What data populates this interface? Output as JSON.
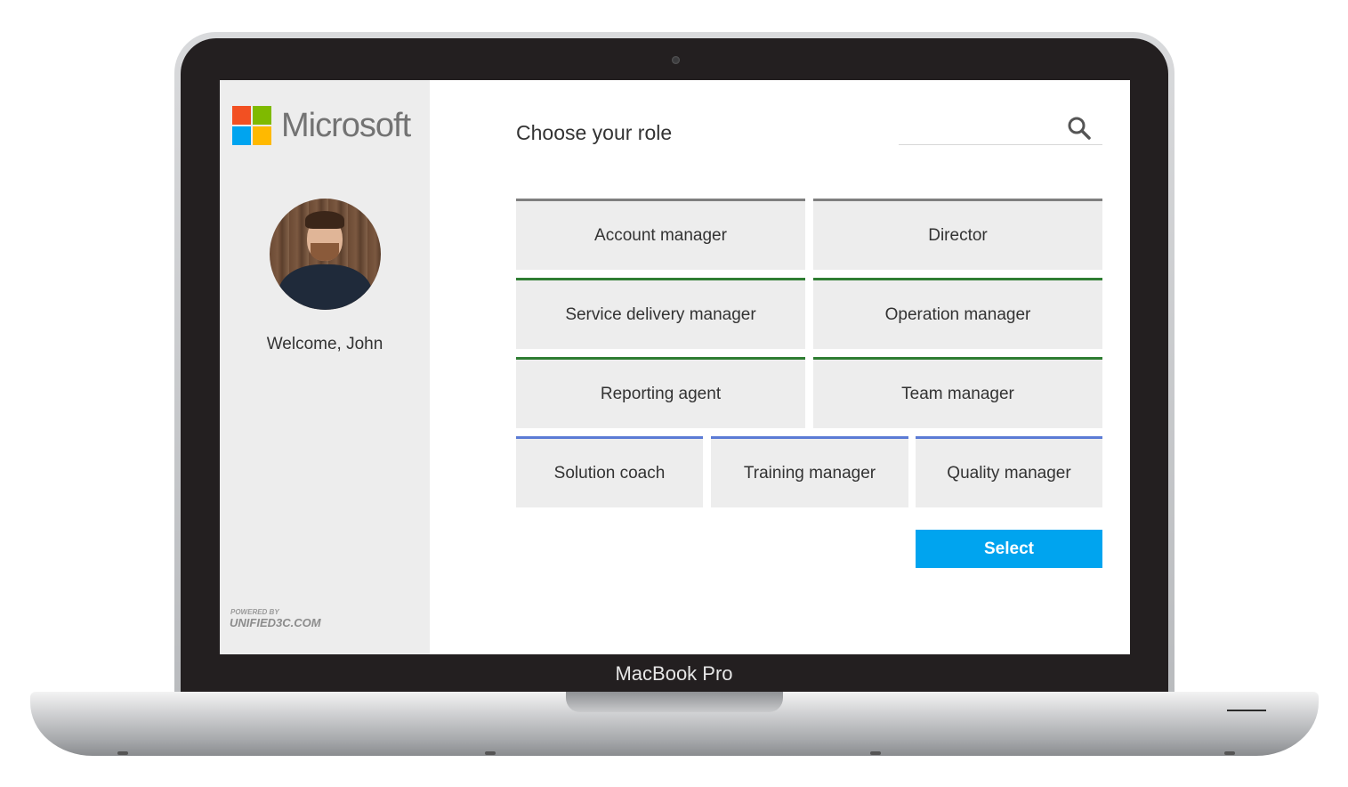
{
  "device": {
    "label": "MacBook Pro"
  },
  "brand": {
    "name": "Microsoft",
    "logo_colors": [
      "#f25022",
      "#7fba00",
      "#00a4ef",
      "#ffb900"
    ]
  },
  "sidebar": {
    "welcome": "Welcome, John",
    "powered_by": "POWERED BY",
    "powered_site": "UNIFIED3C.COM"
  },
  "main": {
    "title": "Choose your role",
    "search": {
      "placeholder": "",
      "icon": "search-icon"
    },
    "roles": [
      {
        "label": "Account manager",
        "accent": "#7f7f7f"
      },
      {
        "label": "Director",
        "accent": "#7f7f7f"
      },
      {
        "label": "Service delivery manager",
        "accent": "#2e7d32"
      },
      {
        "label": "Operation manager",
        "accent": "#2e7d32"
      },
      {
        "label": "Reporting agent",
        "accent": "#2e7d32"
      },
      {
        "label": "Team manager",
        "accent": "#2e7d32"
      },
      {
        "label": "Solution coach",
        "accent": "#5b7bd5"
      },
      {
        "label": "Training manager",
        "accent": "#5b7bd5"
      },
      {
        "label": "Quality manager",
        "accent": "#5b7bd5"
      }
    ],
    "select_label": "Select",
    "select_color": "#00a4ef"
  }
}
